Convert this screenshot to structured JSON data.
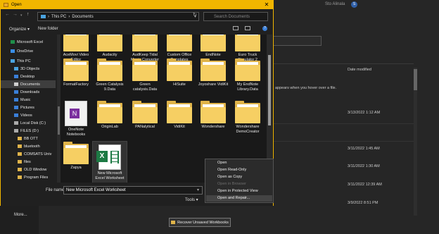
{
  "background": {
    "more_label": "More...",
    "top_right_text": "Sto Alinala",
    "avatar_initial": "S",
    "date_modified_header": "Date modified",
    "hint_text": "appears when you hover over a file.",
    "dates": [
      "3/13/2022 1:12 AM",
      "3/11/2022 1:45 AM",
      "3/11/2022 1:30 AM",
      "3/11/2022 12:39 AM",
      "3/9/2022 8:51 PM"
    ],
    "recover_button": "Recover Unsaved Workbooks"
  },
  "dialog": {
    "title": "Open",
    "close_glyph": "✕",
    "address": {
      "pc": "This PC",
      "sep": "›",
      "folder": "Documents"
    },
    "search_placeholder": "Search Documents",
    "organize_label": "Organize ▾",
    "new_folder_label": "New folder"
  },
  "nav": [
    {
      "label": "Microsoft Excel",
      "color": "#1f8f4a"
    },
    {
      "label": "OneDrive",
      "color": "#3a8ee6"
    },
    {
      "label": "This PC",
      "color": "#4aa3df"
    },
    {
      "label": "3D Objects",
      "color": "#4aa3df"
    },
    {
      "label": "Desktop",
      "color": "#3a7fd8"
    },
    {
      "label": "Documents",
      "color": "#cfcfcf",
      "selected": true
    },
    {
      "label": "Downloads",
      "color": "#3a7fd8"
    },
    {
      "label": "Music",
      "color": "#3a7fd8"
    },
    {
      "label": "Pictures",
      "color": "#3a7fd8"
    },
    {
      "label": "Videos",
      "color": "#3a7fd8"
    },
    {
      "label": "Local Disk (C:)",
      "color": "#aaaaaa"
    },
    {
      "label": "FILES (D:)",
      "color": "#aaaaaa"
    },
    {
      "label": "BB OTT",
      "color": "#e0b44a"
    },
    {
      "label": "bluetooth",
      "color": "#e0b44a"
    },
    {
      "label": "COMSATS Univ",
      "color": "#e0b44a"
    },
    {
      "label": "files",
      "color": "#e0b44a"
    },
    {
      "label": "OLD Window",
      "color": "#e0b44a"
    },
    {
      "label": "Program Files",
      "color": "#e0b44a"
    },
    {
      "label": "Program Files (",
      "color": "#e0b44a"
    }
  ],
  "files": [
    {
      "label": "AceMovi Video Editor",
      "type": "folder"
    },
    {
      "label": "Audacity",
      "type": "folder"
    },
    {
      "label": "AudKeep Tidal Music Converter",
      "type": "folder"
    },
    {
      "label": "Custom Office Templates",
      "type": "folder"
    },
    {
      "label": "EndNote",
      "type": "folder"
    },
    {
      "label": "Euro Truck Simulator 2",
      "type": "folder"
    },
    {
      "label": "FormatFactory",
      "type": "folder"
    },
    {
      "label": "Green Catalysis 9.Data",
      "type": "folder"
    },
    {
      "label": "Green catalysis.Data",
      "type": "folder"
    },
    {
      "label": "HiSuite",
      "type": "folder"
    },
    {
      "label": "Joyoshare VidiKit",
      "type": "folder"
    },
    {
      "label": "My EndNote Library.Data",
      "type": "folder"
    },
    {
      "label": "OneNote Notebooks",
      "type": "onenote"
    },
    {
      "label": "OriginLab",
      "type": "folder"
    },
    {
      "label": "PANalytical",
      "type": "folder"
    },
    {
      "label": "VidiKit",
      "type": "folder"
    },
    {
      "label": "Wondershare",
      "type": "folder"
    },
    {
      "label": "Wondershare DemoCreator",
      "type": "folder"
    },
    {
      "label": "Zapya",
      "type": "folder"
    },
    {
      "label": "New Microsoft Excel Worksheet",
      "type": "excel",
      "selected": true
    }
  ],
  "bottom": {
    "file_name_label": "File name:",
    "file_name_value": "New Microsoft Excel Worksheet",
    "tools_label": "Tools ▾"
  },
  "menu": [
    {
      "label": "Open"
    },
    {
      "label": "Open Read-Only"
    },
    {
      "label": "Open as Copy"
    },
    {
      "label": "Open in Browser",
      "disabled": true
    },
    {
      "label": "Open in Protected View"
    },
    {
      "label": "Open and Repair...",
      "hover": true
    }
  ]
}
